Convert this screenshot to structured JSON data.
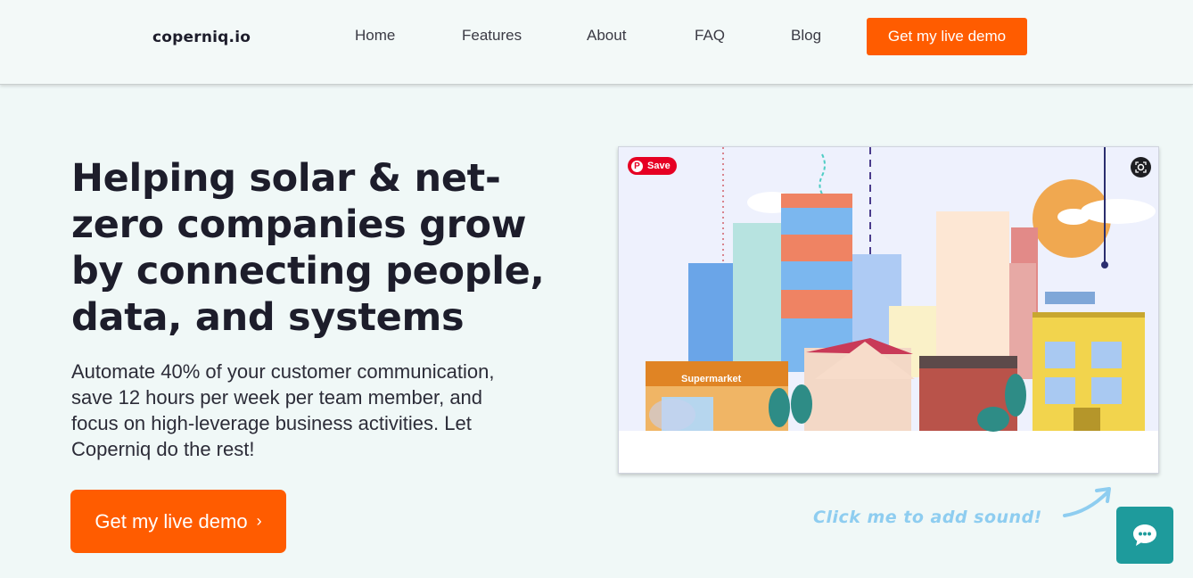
{
  "header": {
    "logo": "coperniq.io",
    "nav": [
      {
        "label": "Home"
      },
      {
        "label": "Features"
      },
      {
        "label": "About"
      },
      {
        "label": "FAQ"
      },
      {
        "label": "Blog"
      }
    ],
    "cta_label": "Get my live demo"
  },
  "hero": {
    "title": "Helping solar & net-zero companies grow by connecting people, data, and systems",
    "subtitle": "Automate 40% of your customer communication, save 12 hours per week per team member, and focus on high-leverage business activities. Let Coperniq do the rest!",
    "cta_label": "Get my live demo",
    "cta_icon": "chevron-right-icon"
  },
  "video": {
    "save_label": "Save",
    "store_sign": "Supermarket"
  },
  "sound_hint": "Click me to add sound!",
  "colors": {
    "accent": "#ff5c00",
    "background": "#f0f8f7",
    "chat": "#1e9b9c",
    "hint": "#8ecdf0"
  }
}
